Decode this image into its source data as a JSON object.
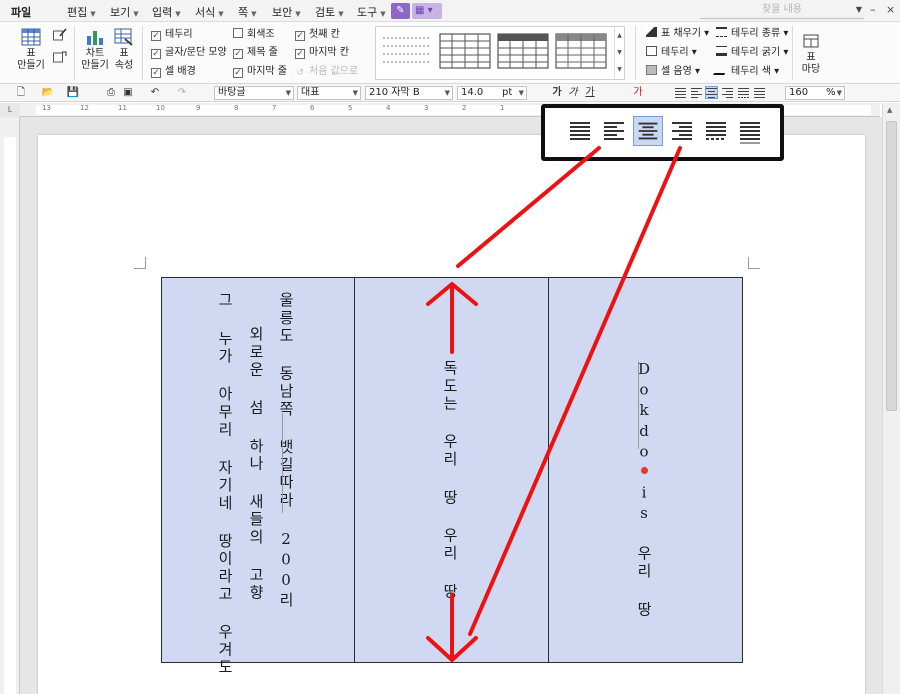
{
  "menu": {
    "items": [
      "파일",
      "편집",
      "보기",
      "입력",
      "서식",
      "쪽",
      "보안",
      "검토",
      "도구"
    ],
    "search_placeholder": "찾을 내용"
  },
  "ribbon": {
    "table_make": "표\n만들기",
    "chart_make": "차트\n만들기",
    "table_props": "표\n속성",
    "cell_background_button": "표\n마당",
    "checkboxes": [
      {
        "label": "테두리",
        "checked": true
      },
      {
        "label": "글자/문단 모양",
        "checked": true
      },
      {
        "label": "셀 배경",
        "checked": true
      },
      {
        "label": "회색조",
        "checked": false
      },
      {
        "label": "제목 줄",
        "checked": true
      },
      {
        "label": "마지막 줄",
        "checked": true
      },
      {
        "label": "첫째 칸",
        "checked": true
      },
      {
        "label": "마지막 칸",
        "checked": true
      },
      {
        "label": "처음 값으로",
        "checked": false,
        "disabled": true
      }
    ],
    "fill_menu": [
      "표 채우기",
      "테두리",
      "셀 음영"
    ],
    "border_menu": [
      "테두리 종류",
      "테두리 굵기",
      "테두리 색"
    ]
  },
  "toolbar": {
    "style": "바탕글",
    "representative": "대표",
    "font": "210 자막 B",
    "size": "14.0",
    "unit": "pt",
    "zoom": "160",
    "zoom_unit": "%",
    "char_buttons": [
      "가",
      "가",
      "가",
      "가"
    ]
  },
  "ruler": {
    "numbers": [
      "13",
      "12",
      "11",
      "10",
      "9",
      "8",
      "7",
      "6",
      "5",
      "4",
      "3",
      "2",
      "1"
    ]
  },
  "table": {
    "cell1_lines": [
      "울릉도 동남쪽 뱃길따라 200리",
      "외로운 섬 하나 새들의 고향",
      "그 누가 아무리 자기네 땅이라고 우겨도"
    ],
    "cell2_text": "독도는 우리 땅 우리 땅",
    "cell3_text": "Dokdo is 우리 땅",
    "fill_color": "#d0d9f1"
  },
  "callout": {
    "buttons": [
      "justify-align",
      "left-align",
      "center-align",
      "right-align",
      "distribute-align",
      "divide-align"
    ],
    "selected": "center-align"
  },
  "annotation_color": "#ee1111"
}
